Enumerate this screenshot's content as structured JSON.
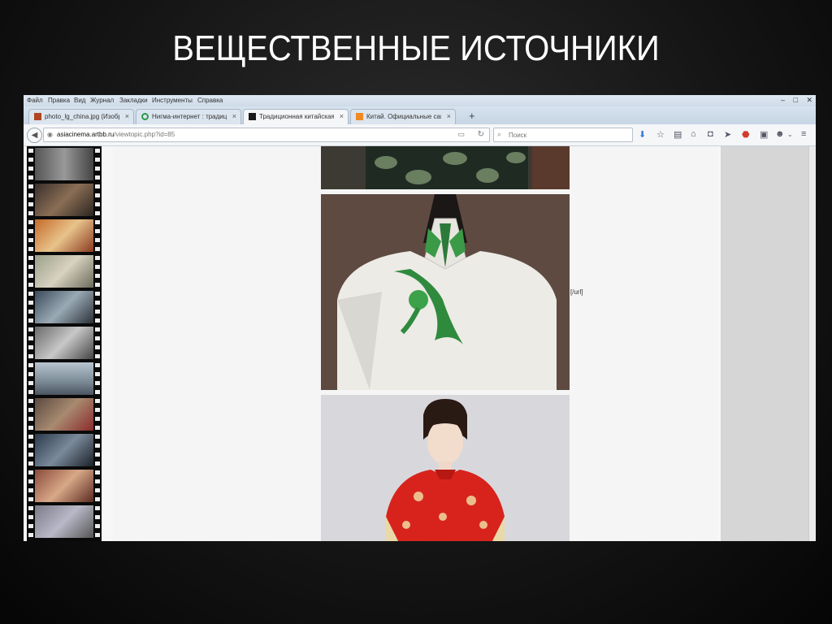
{
  "slide": {
    "title": "ВЕЩЕСТВЕННЫЕ ИСТОЧНИКИ"
  },
  "menu": [
    "Файл",
    "Правка",
    "Вид",
    "Журнал",
    "Закладки",
    "Инструменты",
    "Справка"
  ],
  "tabs": [
    {
      "label": "photo_lg_china.jpg (Изобр...",
      "close": "×",
      "active": false
    },
    {
      "label": "Нигма-интернет : традиц...",
      "close": "×",
      "active": false
    },
    {
      "label": "Традиционная китайская...",
      "close": "×",
      "active": true
    },
    {
      "label": "Китай. Официальные сай...",
      "close": "×",
      "active": false
    }
  ],
  "new_tab": "+",
  "address": {
    "domain": "asiacinema.artbb.ru",
    "path": "/viewtopic.php?id=85"
  },
  "search": {
    "placeholder": "Поиск"
  },
  "page": {
    "url_tag": "[/url]"
  },
  "colors": {
    "accent_blue": "#3b7dd8",
    "abp_red": "#d43a2a"
  }
}
